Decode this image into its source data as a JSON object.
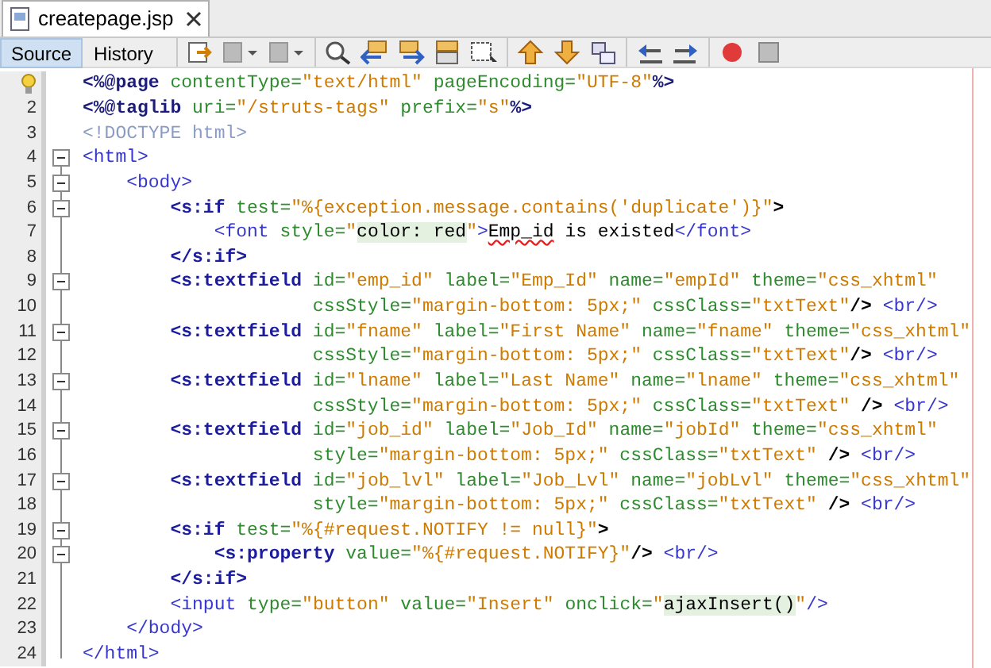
{
  "file_tab": {
    "title": "createpage.jsp"
  },
  "view_tabs": [
    {
      "label": "Source",
      "selected": true
    },
    {
      "label": "History",
      "selected": false
    }
  ],
  "lines": [
    {
      "hint": true,
      "collapsible": false,
      "tokens": [
        {
          "kind": "directive",
          "text": "<%@page"
        },
        {
          "kind": "attr",
          "text": " contentType="
        },
        {
          "kind": "value",
          "text": "\"text/html\""
        },
        {
          "kind": "attr",
          "text": " pageEncoding="
        },
        {
          "kind": "value",
          "text": "\"UTF-8\""
        },
        {
          "kind": "directive",
          "text": "%>"
        }
      ]
    },
    {
      "number": "2",
      "collapsible": false,
      "tokens": [
        {
          "kind": "directive",
          "text": "<%@taglib"
        },
        {
          "kind": "attr",
          "text": " uri="
        },
        {
          "kind": "value",
          "text": "\"/struts-tags\""
        },
        {
          "kind": "attr",
          "text": " prefix="
        },
        {
          "kind": "value",
          "text": "\"s\""
        },
        {
          "kind": "directive",
          "text": "%>"
        }
      ]
    },
    {
      "number": "3",
      "collapsible": false,
      "tokens": [
        {
          "kind": "doctype",
          "text": "<!DOCTYPE html>"
        }
      ]
    },
    {
      "number": "4",
      "collapsible": true,
      "tokens": [
        {
          "kind": "tag",
          "text": "<html>"
        }
      ]
    },
    {
      "number": "5",
      "collapsible": true,
      "tokens": [
        {
          "kind": "tag",
          "text": "    <body>"
        }
      ]
    },
    {
      "number": "6",
      "collapsible": true,
      "tokens": [
        {
          "kind": "stag",
          "text": "        <s:if"
        },
        {
          "kind": "attr",
          "text": " test="
        },
        {
          "kind": "value",
          "text": "\"%{exception.message.contains('duplicate')}\""
        },
        {
          "kind": "punct",
          "text": ">"
        }
      ]
    },
    {
      "number": "7",
      "collapsible": false,
      "tokens": [
        {
          "kind": "tag",
          "text": "            <font"
        },
        {
          "kind": "attr",
          "text": " style="
        },
        {
          "kind": "value",
          "text": "\""
        },
        {
          "kind": "mark",
          "text": "color: red"
        },
        {
          "kind": "value",
          "text": "\""
        },
        {
          "kind": "tag",
          "text": ">"
        },
        {
          "kind": "misspelled",
          "text": "Emp_id"
        },
        {
          "kind": "text",
          "text": " is existed"
        },
        {
          "kind": "tag",
          "text": "</font>"
        }
      ]
    },
    {
      "number": "8",
      "collapsible": false,
      "tokens": [
        {
          "kind": "stag",
          "text": "        </s:if>"
        }
      ]
    },
    {
      "number": "9",
      "collapsible": true,
      "tokens": [
        {
          "kind": "stag",
          "text": "        <s:textfield"
        },
        {
          "kind": "attr",
          "text": " id="
        },
        {
          "kind": "value",
          "text": "\"emp_id\""
        },
        {
          "kind": "attr",
          "text": " label="
        },
        {
          "kind": "value",
          "text": "\"Emp_Id\""
        },
        {
          "kind": "attr",
          "text": " name="
        },
        {
          "kind": "value",
          "text": "\"empId\""
        },
        {
          "kind": "attr",
          "text": " theme="
        },
        {
          "kind": "value",
          "text": "\"css_xhtml\""
        }
      ]
    },
    {
      "number": "10",
      "collapsible": false,
      "tokens": [
        {
          "kind": "attr",
          "text": "                     cssStyle="
        },
        {
          "kind": "value",
          "text": "\"margin-bottom: 5px;\""
        },
        {
          "kind": "attr",
          "text": " cssClass="
        },
        {
          "kind": "value",
          "text": "\"txtText\""
        },
        {
          "kind": "punct",
          "text": "/>"
        },
        {
          "kind": "tag",
          "text": " <br/>"
        }
      ]
    },
    {
      "number": "11",
      "collapsible": true,
      "tokens": [
        {
          "kind": "stag",
          "text": "        <s:textfield"
        },
        {
          "kind": "attr",
          "text": " id="
        },
        {
          "kind": "value",
          "text": "\"fname\""
        },
        {
          "kind": "attr",
          "text": " label="
        },
        {
          "kind": "value",
          "text": "\"First Name\""
        },
        {
          "kind": "attr",
          "text": " name="
        },
        {
          "kind": "value",
          "text": "\"fname\""
        },
        {
          "kind": "attr",
          "text": " theme="
        },
        {
          "kind": "value",
          "text": "\"css_xhtml\""
        }
      ]
    },
    {
      "number": "12",
      "collapsible": false,
      "tokens": [
        {
          "kind": "attr",
          "text": "                     cssStyle="
        },
        {
          "kind": "value",
          "text": "\"margin-bottom: 5px;\""
        },
        {
          "kind": "attr",
          "text": " cssClass="
        },
        {
          "kind": "value",
          "text": "\"txtText\""
        },
        {
          "kind": "punct",
          "text": "/>"
        },
        {
          "kind": "tag",
          "text": " <br/>"
        }
      ]
    },
    {
      "number": "13",
      "collapsible": true,
      "tokens": [
        {
          "kind": "stag",
          "text": "        <s:textfield"
        },
        {
          "kind": "attr",
          "text": " id="
        },
        {
          "kind": "value",
          "text": "\"lname\""
        },
        {
          "kind": "attr",
          "text": " label="
        },
        {
          "kind": "value",
          "text": "\"Last Name\""
        },
        {
          "kind": "attr",
          "text": " name="
        },
        {
          "kind": "value",
          "text": "\"lname\""
        },
        {
          "kind": "attr",
          "text": " theme="
        },
        {
          "kind": "value",
          "text": "\"css_xhtml\""
        }
      ]
    },
    {
      "number": "14",
      "collapsible": false,
      "tokens": [
        {
          "kind": "attr",
          "text": "                     cssStyle="
        },
        {
          "kind": "value",
          "text": "\"margin-bottom: 5px;\""
        },
        {
          "kind": "attr",
          "text": " cssClass="
        },
        {
          "kind": "value",
          "text": "\"txtText\""
        },
        {
          "kind": "punct",
          "text": " />"
        },
        {
          "kind": "tag",
          "text": " <br/>"
        }
      ]
    },
    {
      "number": "15",
      "collapsible": true,
      "tokens": [
        {
          "kind": "stag",
          "text": "        <s:textfield"
        },
        {
          "kind": "attr",
          "text": " id="
        },
        {
          "kind": "value",
          "text": "\"job_id\""
        },
        {
          "kind": "attr",
          "text": " label="
        },
        {
          "kind": "value",
          "text": "\"Job_Id\""
        },
        {
          "kind": "attr",
          "text": " name="
        },
        {
          "kind": "value",
          "text": "\"jobId\""
        },
        {
          "kind": "attr",
          "text": " theme="
        },
        {
          "kind": "value",
          "text": "\"css_xhtml\""
        }
      ]
    },
    {
      "number": "16",
      "collapsible": false,
      "tokens": [
        {
          "kind": "attr",
          "text": "                     style="
        },
        {
          "kind": "value",
          "text": "\"margin-bottom: 5px;\""
        },
        {
          "kind": "attr",
          "text": " cssClass="
        },
        {
          "kind": "value",
          "text": "\"txtText\""
        },
        {
          "kind": "punct",
          "text": " />"
        },
        {
          "kind": "tag",
          "text": " <br/>"
        }
      ]
    },
    {
      "number": "17",
      "collapsible": true,
      "tokens": [
        {
          "kind": "stag",
          "text": "        <s:textfield"
        },
        {
          "kind": "attr",
          "text": " id="
        },
        {
          "kind": "value",
          "text": "\"job_lvl\""
        },
        {
          "kind": "attr",
          "text": " label="
        },
        {
          "kind": "value",
          "text": "\"Job_Lvl\""
        },
        {
          "kind": "attr",
          "text": " name="
        },
        {
          "kind": "value",
          "text": "\"jobLvl\""
        },
        {
          "kind": "attr",
          "text": " theme="
        },
        {
          "kind": "value",
          "text": "\"css_xhtml\""
        }
      ]
    },
    {
      "number": "18",
      "collapsible": false,
      "tokens": [
        {
          "kind": "attr",
          "text": "                     style="
        },
        {
          "kind": "value",
          "text": "\"margin-bottom: 5px;\""
        },
        {
          "kind": "attr",
          "text": " cssClass="
        },
        {
          "kind": "value",
          "text": "\"txtText\""
        },
        {
          "kind": "punct",
          "text": " />"
        },
        {
          "kind": "tag",
          "text": " <br/>"
        }
      ]
    },
    {
      "number": "19",
      "collapsible": true,
      "tokens": [
        {
          "kind": "stag",
          "text": "        <s:if"
        },
        {
          "kind": "attr",
          "text": " test="
        },
        {
          "kind": "value",
          "text": "\"%{#request.NOTIFY != null}\""
        },
        {
          "kind": "punct",
          "text": ">"
        }
      ]
    },
    {
      "number": "20",
      "collapsible": true,
      "tokens": [
        {
          "kind": "stag",
          "text": "            <s:property"
        },
        {
          "kind": "attr",
          "text": " value="
        },
        {
          "kind": "value",
          "text": "\"%{#request.NOTIFY}\""
        },
        {
          "kind": "punct",
          "text": "/>"
        },
        {
          "kind": "tag",
          "text": " <br/>"
        }
      ]
    },
    {
      "number": "21",
      "collapsible": false,
      "tokens": [
        {
          "kind": "stag",
          "text": "        </s:if>"
        }
      ]
    },
    {
      "number": "22",
      "collapsible": false,
      "tokens": [
        {
          "kind": "tag",
          "text": "        <input"
        },
        {
          "kind": "attr",
          "text": " type="
        },
        {
          "kind": "value",
          "text": "\"button\""
        },
        {
          "kind": "attr",
          "text": " value="
        },
        {
          "kind": "value",
          "text": "\"Insert\""
        },
        {
          "kind": "attr",
          "text": " onclick="
        },
        {
          "kind": "value",
          "text": "\""
        },
        {
          "kind": "mark",
          "text": "ajaxInsert()"
        },
        {
          "kind": "value",
          "text": "\""
        },
        {
          "kind": "tag",
          "text": "/>"
        }
      ]
    },
    {
      "number": "23",
      "collapsible": false,
      "tokens": [
        {
          "kind": "tag",
          "text": "    </body>"
        }
      ]
    },
    {
      "number": "24",
      "collapsible": false,
      "tokens": [
        {
          "kind": "tag",
          "text": "</html>"
        }
      ]
    }
  ]
}
